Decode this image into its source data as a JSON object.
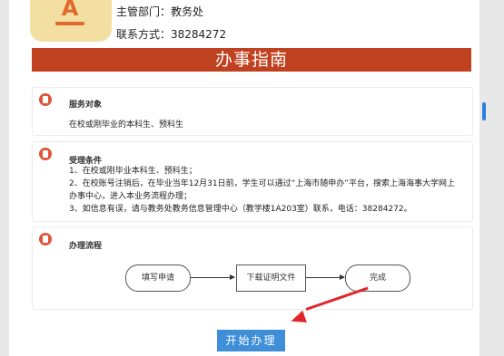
{
  "header": {
    "department_label": "主管部门：教务处",
    "contact_label": "联系方式：38284272"
  },
  "banner": {
    "title": "办事指南"
  },
  "sections": [
    {
      "title": "服务对象",
      "lines": [
        "在校或刚毕业的本科生、预科生"
      ]
    },
    {
      "title": "受理条件",
      "lines": [
        "1、在校或刚毕业本科生、预科生；",
        "2、在校账号注销后，在毕业当年12月31日前，学生可以通过“上海市随申办”平台，搜索上海海事大学网上",
        "办事中心，进入本业务流程办理；",
        "3、如信息有误，请与教务处教务信息管理中心（教学楼1A203室）联系，电话：38284272。"
      ]
    },
    {
      "title": "办理流程",
      "flow": [
        "填写申请",
        "下载证明文件",
        "完成"
      ]
    }
  ],
  "actions": {
    "start_label": "开始办理"
  },
  "icons": {
    "logo": "a-letter-logo",
    "section_icon": "document-icon"
  },
  "colors": {
    "banner": "#c0411f",
    "button": "#3f8fd8",
    "annotation_arrow": "#e0262a"
  }
}
